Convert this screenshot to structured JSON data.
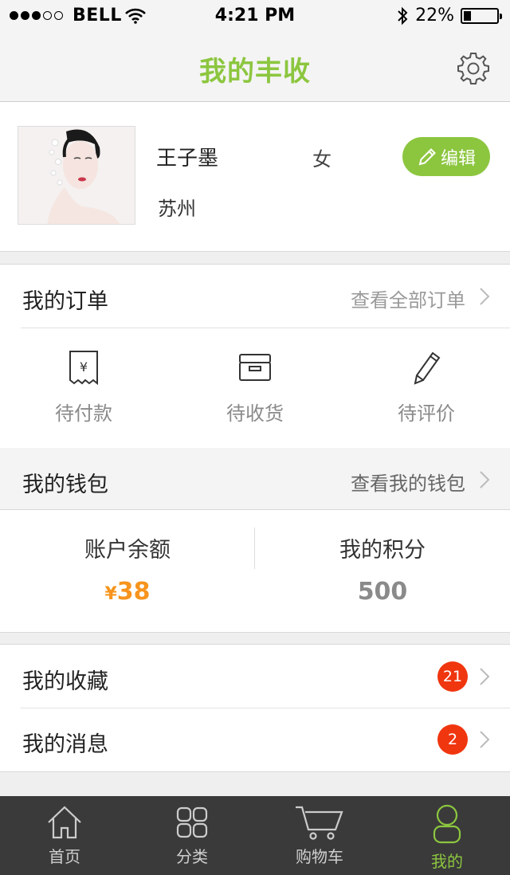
{
  "status_bar": {
    "carrier": "BELL",
    "time": "4:21 PM",
    "battery": "22%",
    "battery_level": 0.22,
    "signal_dots_on": 3,
    "signal_dots_total": 5
  },
  "nav": {
    "title": "我的丰收",
    "settings_icon": "gear-icon"
  },
  "profile": {
    "name": "王子墨",
    "gender": "女",
    "city": "苏州",
    "edit_label": "编辑"
  },
  "orders": {
    "title": "我的订单",
    "view_all": "查看全部订单",
    "items": [
      {
        "label": "待付款",
        "icon": "receipt-yen-icon"
      },
      {
        "label": "待收货",
        "icon": "box-icon"
      },
      {
        "label": "待评价",
        "icon": "pencil-icon"
      }
    ]
  },
  "wallet": {
    "title": "我的钱包",
    "view_link": "查看我的钱包",
    "balance_label": "账户余额",
    "balance_currency": "¥",
    "balance_value": "38",
    "points_label": "我的积分",
    "points_value": "500"
  },
  "lists": {
    "favorites": {
      "label": "我的收藏",
      "badge": "21"
    },
    "messages": {
      "label": "我的消息",
      "badge": "2"
    }
  },
  "tabbar": {
    "items": [
      {
        "label": "首页",
        "icon": "home-icon"
      },
      {
        "label": "分类",
        "icon": "grid-icon"
      },
      {
        "label": "购物车",
        "icon": "cart-icon"
      },
      {
        "label": "我的",
        "icon": "user-icon"
      }
    ],
    "active_index": 3
  },
  "colors": {
    "accent": "#8cc63f",
    "price": "#f7941d",
    "badge": "#f0360f",
    "tabbar_bg": "#3a3a3a"
  }
}
